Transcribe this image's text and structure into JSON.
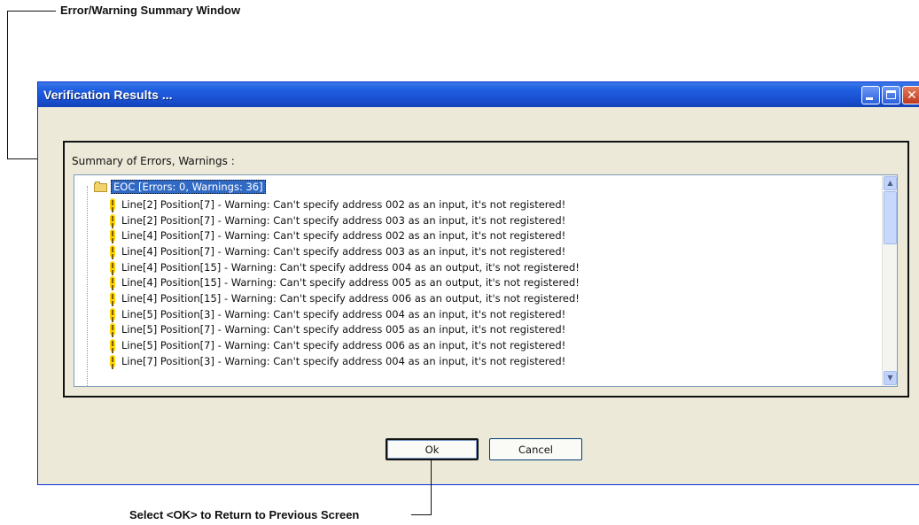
{
  "annotations": {
    "top_callout": "Error/Warning Summary Window",
    "bottom_callout": "Select <OK> to Return to Previous Screen"
  },
  "window": {
    "title": "Verification Results ...",
    "controls": [
      "minimize-icon",
      "maximize-icon",
      "close-icon"
    ]
  },
  "summary": {
    "group_label": "Summary of Errors, Warnings :",
    "root": "EOC  [Errors: 0, Warnings: 36]",
    "items": [
      "Line[2] Position[7] - Warning: Can't specify address 002 as an input, it's not registered!",
      "Line[2] Position[7] - Warning: Can't specify address 003 as an input, it's not registered!",
      "Line[4] Position[7] - Warning: Can't specify address 002 as an input, it's not registered!",
      "Line[4] Position[7] - Warning: Can't specify address 003 as an input, it's not registered!",
      "Line[4] Position[15] - Warning: Can't specify address 004 as an output, it's not registered!",
      "Line[4] Position[15] - Warning: Can't specify address 005 as an output, it's not registered!",
      "Line[4] Position[15] - Warning: Can't specify address 006 as an output, it's not registered!",
      "Line[5] Position[3] - Warning: Can't specify address 004 as an input, it's not registered!",
      "Line[5] Position[7] - Warning: Can't specify address 005 as an input, it's not registered!",
      "Line[5] Position[7] - Warning: Can't specify address 006 as an input, it's not registered!",
      "Line[7] Position[3] - Warning: Can't specify address 004 as an input, it's not registered!"
    ]
  },
  "buttons": {
    "ok": "Ok",
    "cancel": "Cancel"
  }
}
